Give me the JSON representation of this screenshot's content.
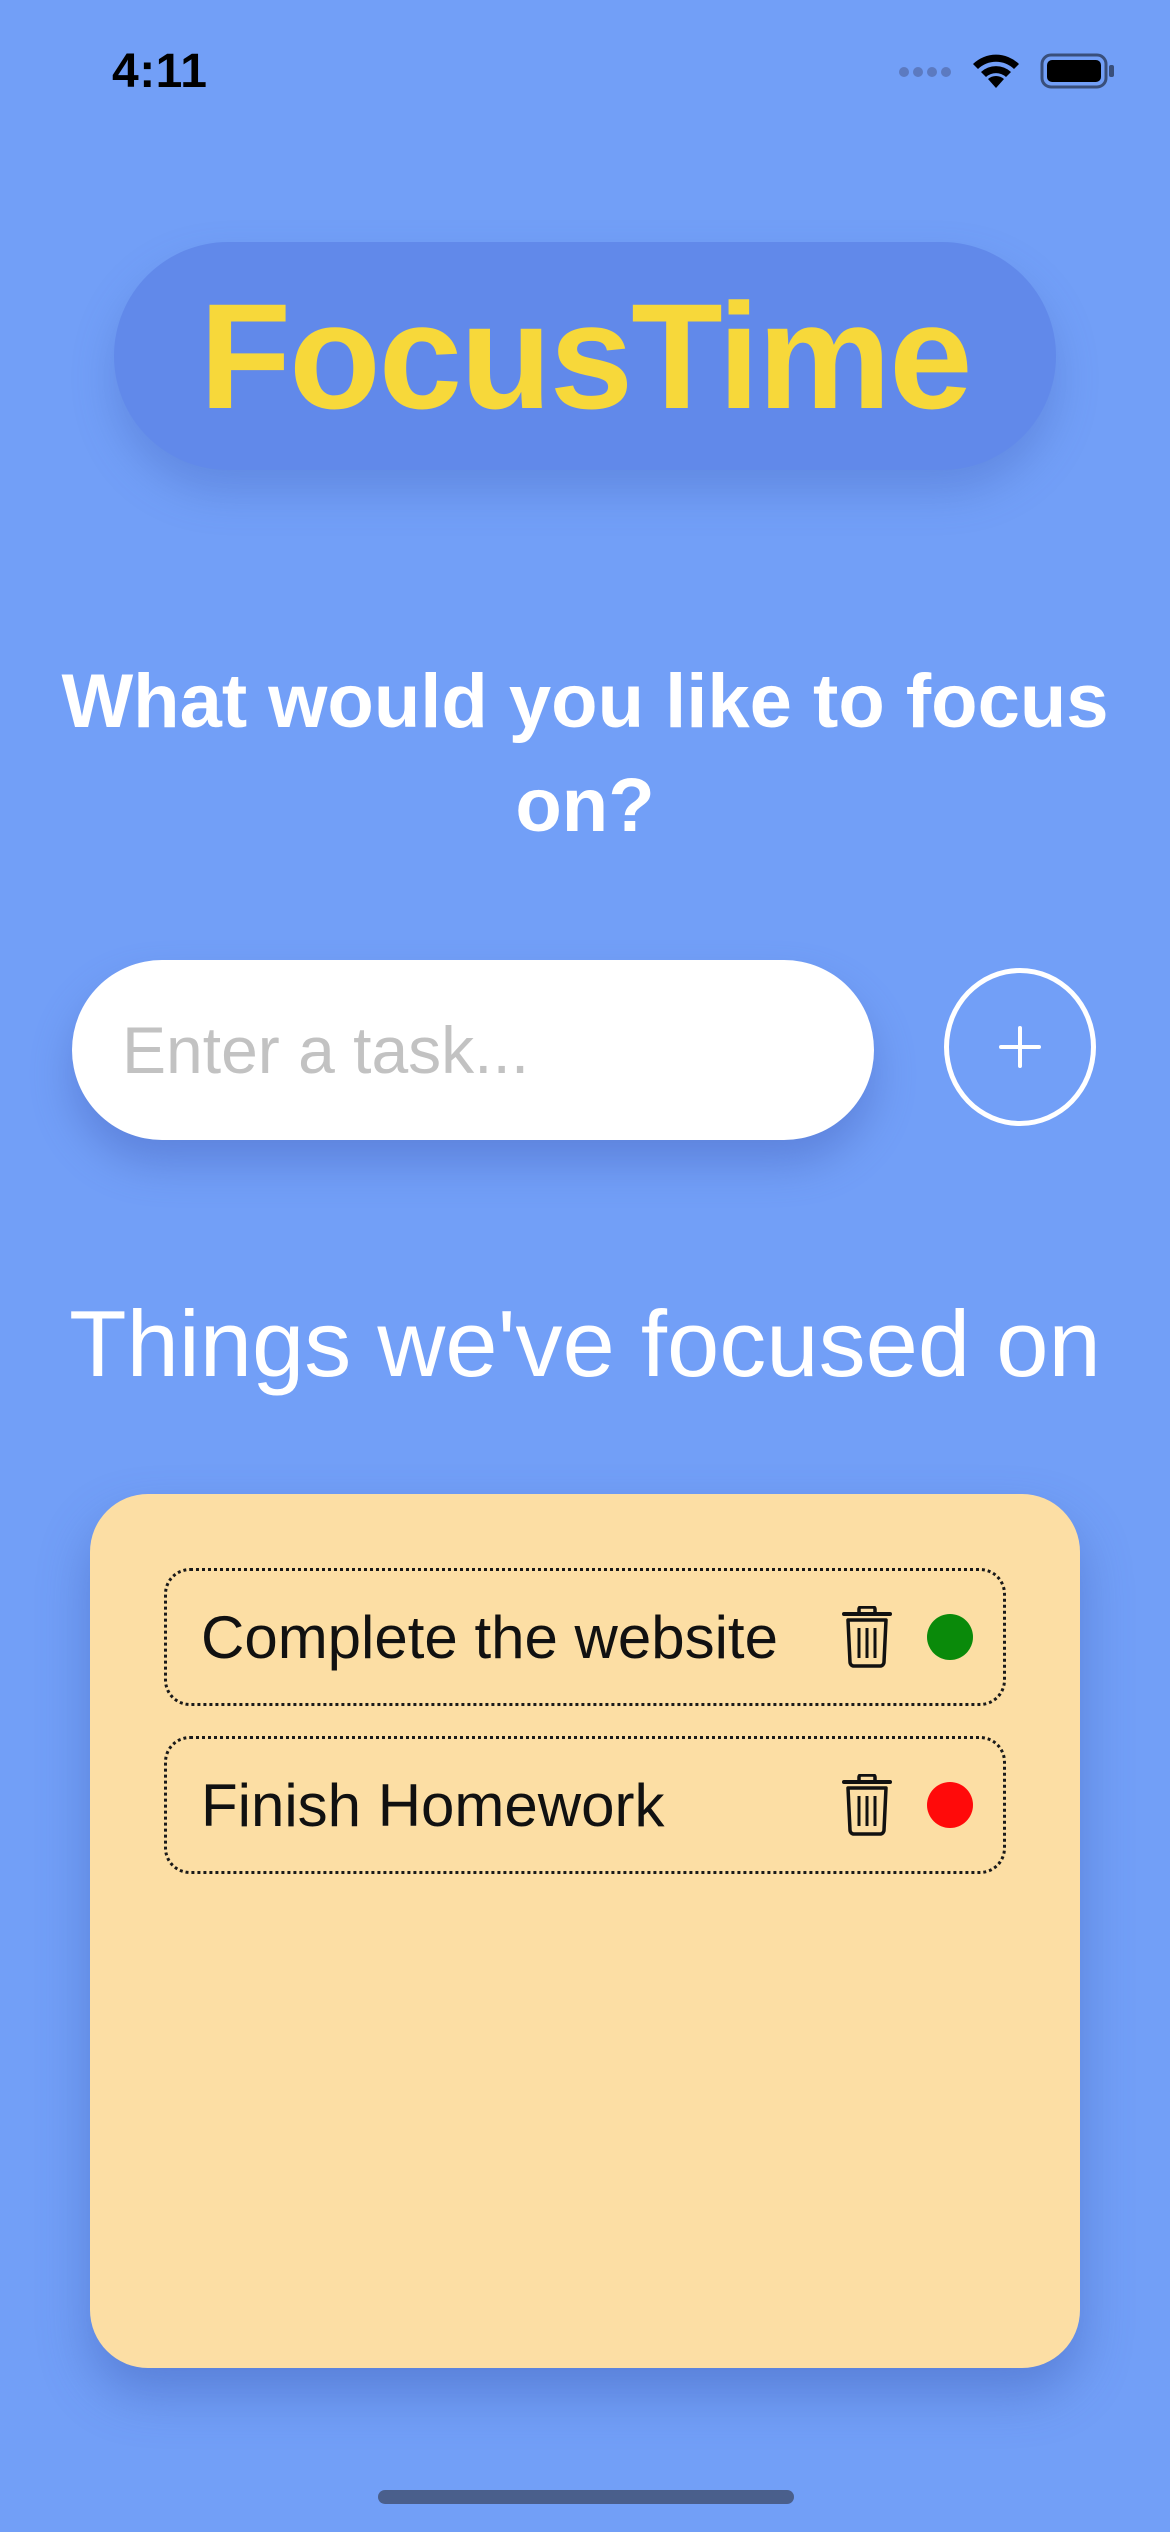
{
  "status_bar": {
    "time": "4:11"
  },
  "app": {
    "title": "FocusTime"
  },
  "prompt": {
    "question": "What would you like to focus on?"
  },
  "task_input": {
    "placeholder": "Enter a task...",
    "value": ""
  },
  "add_button": {
    "label": "+"
  },
  "history": {
    "heading": "Things we've focused on",
    "items": [
      {
        "label": "Complete the website",
        "status": "complete",
        "status_color": "#0a8a0a"
      },
      {
        "label": "Finish Homework",
        "status": "incomplete",
        "status_color": "#ff0a0a"
      }
    ]
  },
  "colors": {
    "background": "#729ff7",
    "title_pill": "#6189ea",
    "title_text": "#f7d83a",
    "card": "#fcdea4"
  },
  "icons": {
    "signal": "cellular-signal-icon",
    "wifi": "wifi-icon",
    "battery": "battery-icon",
    "trash": "trash-icon",
    "plus": "plus-icon"
  }
}
